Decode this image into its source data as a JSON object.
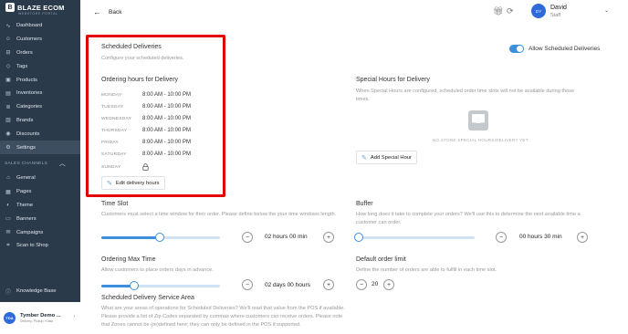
{
  "sidebar": {
    "logo": "BLAZE ECOM",
    "logo_sub": "WEBSTORE PORTAL",
    "items": [
      {
        "label": "Dashboard",
        "icon": "pulse-icon"
      },
      {
        "label": "Customers",
        "icon": "users-icon"
      },
      {
        "label": "Orders",
        "icon": "cart-icon"
      },
      {
        "label": "Tags",
        "icon": "tag-icon"
      },
      {
        "label": "Products",
        "icon": "box-icon"
      },
      {
        "label": "Inventories",
        "icon": "inventory-icon"
      },
      {
        "label": "Categories",
        "icon": "layers-icon"
      },
      {
        "label": "Brands",
        "icon": "brand-icon"
      },
      {
        "label": "Discounts",
        "icon": "discount-icon"
      },
      {
        "label": "Settings",
        "icon": "gear-icon"
      }
    ],
    "section_label": "SALES CHANNELS",
    "channel_items": [
      {
        "label": "General",
        "icon": "general-icon"
      },
      {
        "label": "Pages",
        "icon": "pages-icon"
      },
      {
        "label": "Theme",
        "icon": "theme-icon"
      },
      {
        "label": "Banners",
        "icon": "banner-icon"
      },
      {
        "label": "Campaigns",
        "icon": "campaign-icon"
      },
      {
        "label": "Scan to Shop",
        "icon": "scan-icon"
      }
    ],
    "knowledge_base": "Knowledge Base",
    "store": {
      "initials": "TDA",
      "name": "Tymber Demo ...",
      "sub": "Delivery, Pickup, Kiosk"
    }
  },
  "header": {
    "back_label": "Back",
    "user": {
      "initials": "DY",
      "name": "David",
      "role": "Staff"
    }
  },
  "scheduled": {
    "title": "Scheduled Deliveries",
    "subtitle": "Configure your scheduled deliveries.",
    "toggle_label": "Allow Scheduled Deliveries",
    "hours_title": "Ordering hours for Delivery",
    "days": [
      {
        "day": "MONDAY",
        "hours": "8:00 AM - 10:00 PM"
      },
      {
        "day": "TUESDAY",
        "hours": "8:00 AM - 10:00 PM"
      },
      {
        "day": "WEDNESDAY",
        "hours": "8:00 AM - 10:00 PM"
      },
      {
        "day": "THURSDAY",
        "hours": "8:00 AM - 10:00 PM"
      },
      {
        "day": "FRIDAY",
        "hours": "8:00 AM - 10:00 PM"
      },
      {
        "day": "SATURDAY",
        "hours": "8:00 AM - 10:00 PM"
      },
      {
        "day": "SUNDAY",
        "hours": ""
      }
    ],
    "edit_button": "Edit delivery hours"
  },
  "special": {
    "title": "Special Hours for Delivery",
    "desc": "When Special Hours are configured, scheduled order time slots will not be available during those times.",
    "empty": "NO STORE SPECIAL HOURS/DELIVERY YET.",
    "add_button": "Add Special Hour"
  },
  "time_slot": {
    "title": "Time Slot",
    "desc": "Customers must select a time window for their order. Please define below the your time windows length.",
    "value": "02 hours 00 min",
    "level": 0.49
  },
  "buffer": {
    "title": "Buffer",
    "desc": "How long does it take to complete your orders? We'll use this to determine the next available time a customer can order.",
    "value": "00 hours 30 min",
    "level": 0.0
  },
  "max_time": {
    "title": "Ordering Max Time",
    "desc": "Allow customers to place orders days in advance.",
    "value": "02 days 00 hours",
    "level": 0.28
  },
  "order_limit": {
    "title": "Default order limit",
    "desc": "Define the number of orders are able to fulfill in each time slot.",
    "value": "20"
  },
  "service_area": {
    "title": "Scheduled Delivery Service Area",
    "desc": "What are your areas of operations for Scheduled Deliveries? We'll read that value from the POS if available. Please provide a list of Zip Codes separated by commas where customers can receive orders. Please note that Zones cannot be (re)defined here; they can only be defined in the POS if supported."
  },
  "colors": {
    "accent": "#3b8fdc",
    "sidebar": "#2b3a4a",
    "highlight": "#e40000"
  }
}
